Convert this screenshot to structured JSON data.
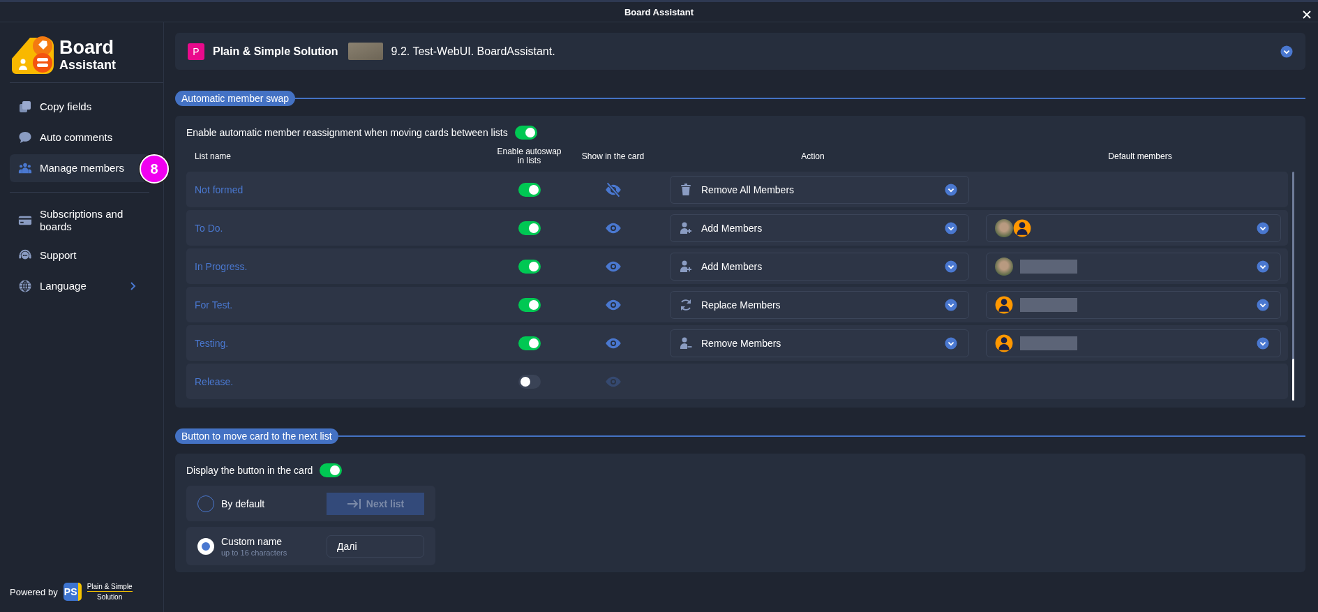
{
  "window": {
    "title": "Board Assistant"
  },
  "sidebar": {
    "logo": {
      "title": "Board",
      "subtitle": "Assistant"
    },
    "item_groups": [
      [
        {
          "kind": "copy",
          "label": "Copy fields",
          "selected": false,
          "has_submenu": false
        },
        {
          "kind": "comments",
          "label": "Auto comments",
          "selected": false,
          "has_submenu": false
        },
        {
          "kind": "members",
          "label": "Manage members",
          "selected": true,
          "has_submenu": false,
          "badge": "8"
        }
      ],
      [
        {
          "kind": "card",
          "label": "Subscriptions and boards",
          "selected": false,
          "has_submenu": false
        },
        {
          "kind": "support",
          "label": "Support",
          "selected": false,
          "has_submenu": false
        },
        {
          "kind": "globe",
          "label": "Language",
          "selected": false,
          "has_submenu": true
        }
      ]
    ],
    "powered_by": {
      "label": "Powered by",
      "logo_mark": "PS",
      "logo_line_1": "Plain & Simple",
      "logo_line_2": "Solution"
    }
  },
  "header": {
    "workspace_initial": "P",
    "workspace": "Plain & Simple Solution",
    "board": "9.2. Test-WebUI. BoardAssistant."
  },
  "member_swap": {
    "title": "Automatic member swap",
    "toggle_label": "Enable automatic member reassignment when moving cards between lists",
    "enabled": true,
    "columns": [
      "List name",
      "Enable autoswap in lists",
      "Show in the card",
      "Action",
      "Default members"
    ],
    "rows": [
      {
        "list_name": "Not formed",
        "autoswap": true,
        "show_in_card": false,
        "action": {
          "kind": "remove_all",
          "label": "Remove All Members"
        }
      },
      {
        "list_name": "To Do.",
        "autoswap": true,
        "show_in_card": true,
        "action": {
          "kind": "add",
          "label": "Add Members"
        },
        "members": {
          "avatars": [
            {
              "kind": "photo"
            },
            {
              "kind": "silhouette"
            }
          ],
          "name_redacted": false
        }
      },
      {
        "list_name": "In Progress.",
        "autoswap": true,
        "show_in_card": true,
        "action": {
          "kind": "add",
          "label": "Add Members"
        },
        "members": {
          "avatars": [
            {
              "kind": "photo"
            }
          ],
          "name_redacted": true
        }
      },
      {
        "list_name": "For Test.",
        "autoswap": true,
        "show_in_card": true,
        "action": {
          "kind": "replace",
          "label": "Replace Members"
        },
        "members": {
          "avatars": [
            {
              "kind": "silhouette"
            }
          ],
          "name_redacted": true
        }
      },
      {
        "list_name": "Testing.",
        "autoswap": true,
        "show_in_card": true,
        "action": {
          "kind": "remove",
          "label": "Remove Members"
        },
        "members": {
          "avatars": [
            {
              "kind": "silhouette"
            }
          ],
          "name_redacted": true
        }
      },
      {
        "list_name": "Release.",
        "autoswap": false,
        "show_in_card": true
      }
    ]
  },
  "next_list_button": {
    "title": "Button to move card to the next list",
    "toggle_label": "Display the button in the card",
    "enabled": true,
    "options": [
      {
        "kind": "preview",
        "label": "By default",
        "selected": false,
        "button_label": "Next list"
      },
      {
        "kind": "input",
        "label": "Custom name",
        "hint": "up to 16 characters",
        "selected": true,
        "value": "Далі"
      }
    ]
  }
}
